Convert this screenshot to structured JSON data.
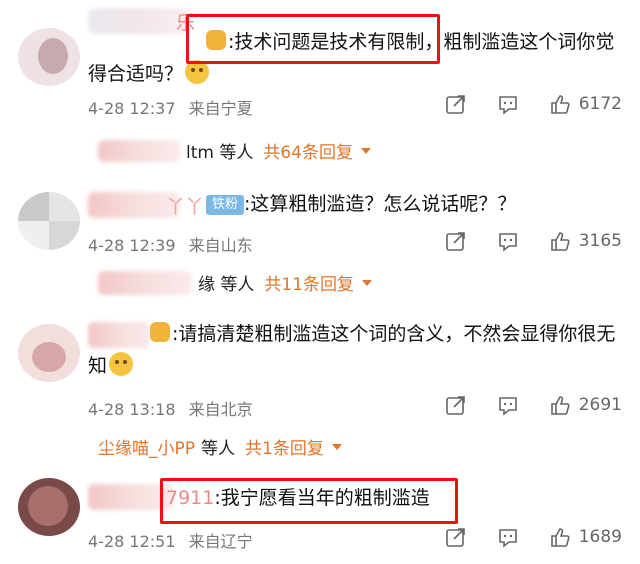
{
  "comments": [
    {
      "name_tail": "乐",
      "text_line1": ":技术问题是技术有限制，粗制滥造这个词你觉",
      "text_line2": "得合适吗？",
      "time": "4-28 12:37",
      "location": "来自宁夏",
      "likes": "6172",
      "reply_who": "ltm 等人",
      "reply_total": "共64条回复"
    },
    {
      "name_tail": "丫丫",
      "badge": "铁粉",
      "text_line1": ":这算粗制滥造？怎么说话呢？？",
      "time": "4-28 12:39",
      "location": "来自山东",
      "likes": "3165",
      "reply_who": "缘 等人",
      "reply_total": "共11条回复"
    },
    {
      "text_line1": ":请搞清楚粗制滥造这个词的含义，不然会显得你很无",
      "text_line2": "知",
      "time": "4-28 13:18",
      "location": "来自北京",
      "likes": "2691",
      "reply_name": "尘缘喵_小PP",
      "reply_who": "等人",
      "reply_total": "共1条回复"
    },
    {
      "name_tail": "7911",
      "text_line1": ":我宁愿看当年的粗制滥造",
      "time": "4-28 12:51",
      "location": "来自辽宁",
      "likes": "1689"
    }
  ],
  "icons": [
    "share-icon",
    "comment-icon",
    "like-icon"
  ],
  "colors": {
    "accent": "#e0752c",
    "highlight": "#ee1111",
    "fan_badge": "#7ab8e6"
  }
}
